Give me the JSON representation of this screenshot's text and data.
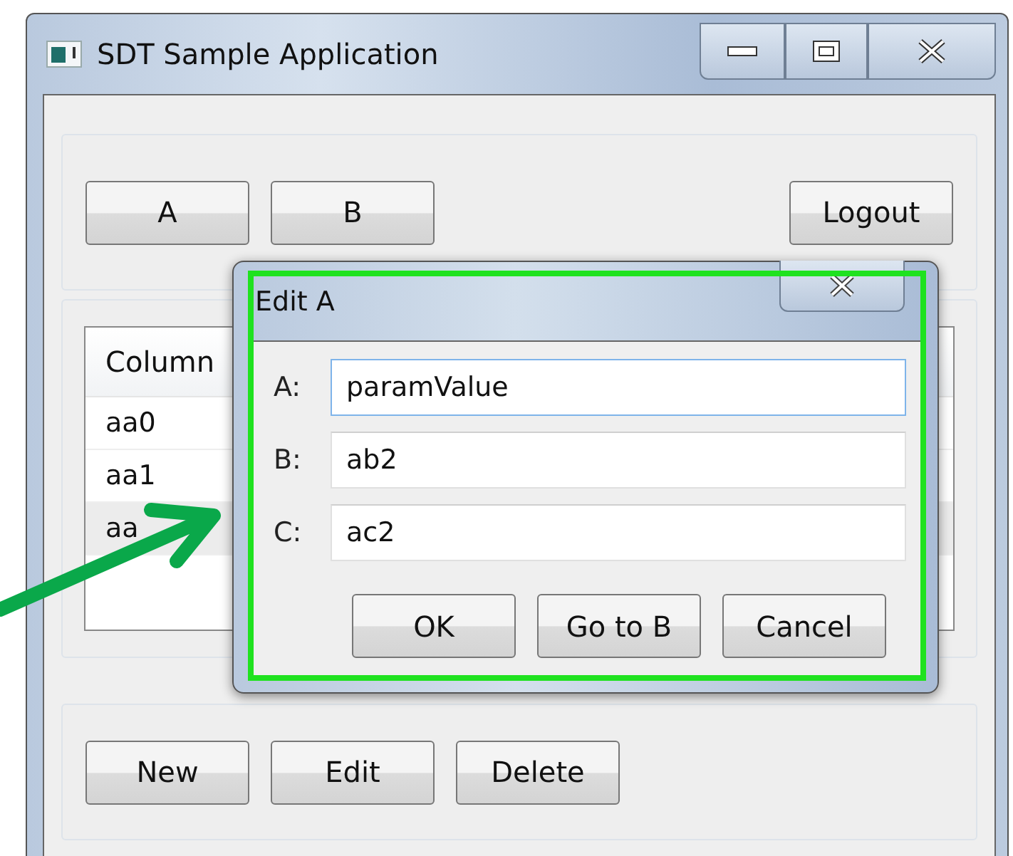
{
  "window": {
    "title": "SDT Sample Application",
    "controls": [
      {
        "kind": "minimize"
      },
      {
        "kind": "maximize"
      },
      {
        "kind": "close"
      }
    ]
  },
  "top_buttons": [
    "A",
    "B"
  ],
  "logout_button": "Logout",
  "table": {
    "columns": [
      "Column"
    ],
    "rows": [
      {
        "cells": [
          "aa0"
        ],
        "selected": false
      },
      {
        "cells": [
          "aa1"
        ],
        "selected": false
      },
      {
        "cells": [
          "aa"
        ],
        "selected": true
      }
    ]
  },
  "bottom_buttons": [
    "New",
    "Edit",
    "Delete"
  ],
  "dialog": {
    "title": "Edit A",
    "highlighted": true,
    "fields": [
      {
        "label": "A:",
        "value": "paramValue",
        "focused": true
      },
      {
        "label": "B:",
        "value": "ab2",
        "focused": false
      },
      {
        "label": "C:",
        "value": "ac2",
        "focused": false
      }
    ],
    "buttons": [
      "OK",
      "Go to B",
      "Cancel"
    ]
  },
  "annotation": {
    "kind": "arrow"
  }
}
